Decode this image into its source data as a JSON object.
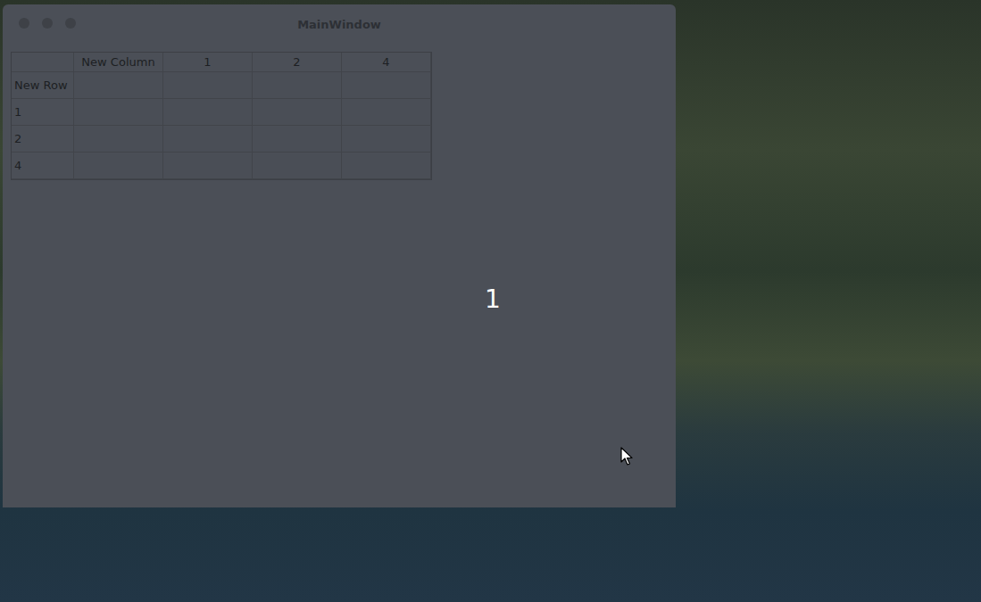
{
  "window": {
    "title": "MainWindow"
  },
  "table": {
    "columns": [
      "New Column",
      "1",
      "2",
      "4"
    ],
    "rows": [
      {
        "header": "New Row",
        "cells": [
          "",
          "",
          "",
          ""
        ]
      },
      {
        "header": "1",
        "cells": [
          "",
          "",
          "",
          ""
        ]
      },
      {
        "header": "2",
        "cells": [
          "",
          "",
          "",
          ""
        ]
      },
      {
        "header": "4",
        "cells": [
          "",
          "",
          "",
          ""
        ]
      }
    ]
  },
  "central_label": "1"
}
